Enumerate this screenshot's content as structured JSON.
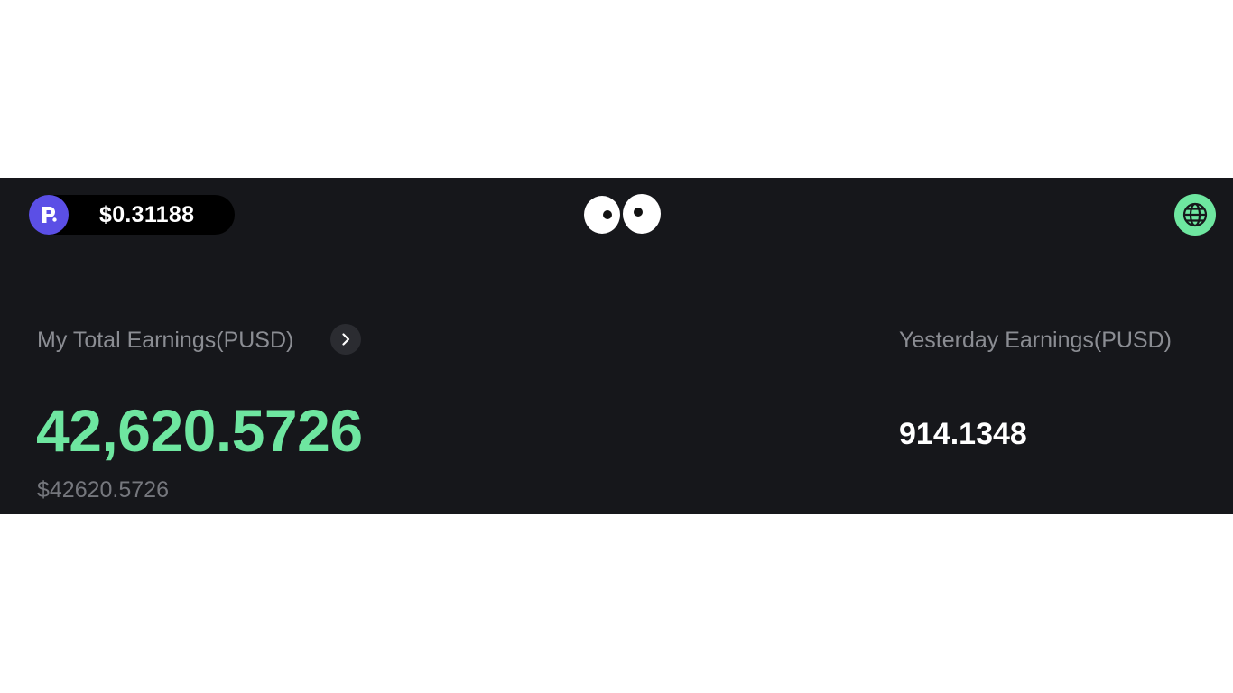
{
  "header": {
    "token_price": "$0.31188",
    "logo_icon": "p-logo-icon",
    "center_icon": "googly-eyes-icon",
    "language_icon": "globe-icon"
  },
  "earnings": {
    "total_label": "My Total Earnings(PUSD)",
    "total_value": "42,620.5726",
    "total_usd": "$42620.5726",
    "details_icon": "chevron-right-icon",
    "yesterday_label": "Yesterday Earnings(PUSD)",
    "yesterday_value": "914.1348"
  },
  "colors": {
    "background": "#16171b",
    "accent_green": "#6ee6a0",
    "brand_purple": "#5b4fe6",
    "muted_text": "#8b8d93"
  }
}
